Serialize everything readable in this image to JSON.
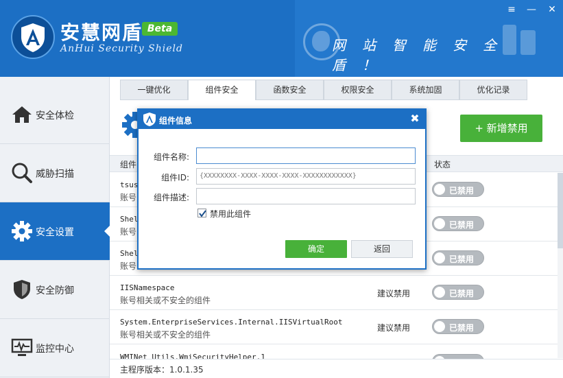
{
  "header": {
    "title": "安慧网盾",
    "beta": "Beta",
    "subtitle": "AnHui Security Shield",
    "slogan": "网站智能安全盾！",
    "window_controls": {
      "menu": "≡",
      "minimize": "—",
      "close": "✕"
    }
  },
  "sidebar": {
    "items": [
      {
        "label": "安全体检",
        "icon": "house-icon"
      },
      {
        "label": "威胁扫描",
        "icon": "magnifier-icon"
      },
      {
        "label": "安全设置",
        "icon": "gear-icon",
        "active": true
      },
      {
        "label": "安全防御",
        "icon": "shield-icon"
      },
      {
        "label": "监控中心",
        "icon": "monitor-icon"
      }
    ]
  },
  "tabs": [
    {
      "label": "一键优化"
    },
    {
      "label": "组件安全",
      "active": true
    },
    {
      "label": "函数安全"
    },
    {
      "label": "权限安全"
    },
    {
      "label": "系统加固"
    },
    {
      "label": "优化记录"
    }
  ],
  "main": {
    "add_button": "+ 新增禁用",
    "columns": {
      "name": "组件",
      "status": "状态"
    },
    "rows": [
      {
        "name": "tsus",
        "desc": "账号",
        "suggest": "",
        "toggle": "已禁用"
      },
      {
        "name": "Shel",
        "desc": "账号",
        "suggest": "",
        "toggle": "已禁用"
      },
      {
        "name": "Shel",
        "desc": "账号",
        "suggest": "",
        "toggle": "已禁用"
      },
      {
        "name": "IISNamespace",
        "desc": "账号相关或不安全的组件",
        "suggest": "建议禁用",
        "toggle": "已禁用"
      },
      {
        "name": "System.EnterpriseServices.Internal.IISVirtualRoot",
        "desc": "账号相关或不安全的组件",
        "suggest": "建议禁用",
        "toggle": "已禁用"
      },
      {
        "name": "WMINet_Utils.WmiSecurityHelper.1",
        "desc": "",
        "suggest": "",
        "toggle": ""
      }
    ],
    "version": "主程序版本：1.0.1.35"
  },
  "dialog": {
    "title": "组件信息",
    "close": "✖",
    "fields": {
      "name_label": "组件名称:",
      "name_value": "",
      "id_label": "组件ID:",
      "id_value": "{XXXXXXXX-XXXX-XXXX-XXXX-XXXXXXXXXXXX}",
      "desc_label": "组件描述:",
      "desc_value": ""
    },
    "checkbox_label": "禁用此组件",
    "checkbox_checked": true,
    "ok_label": "确定",
    "cancel_label": "返回"
  },
  "colors": {
    "brand_blue": "#1c6fc4",
    "accent_green": "#48b13a",
    "toggle_gray": "#b5babf"
  }
}
